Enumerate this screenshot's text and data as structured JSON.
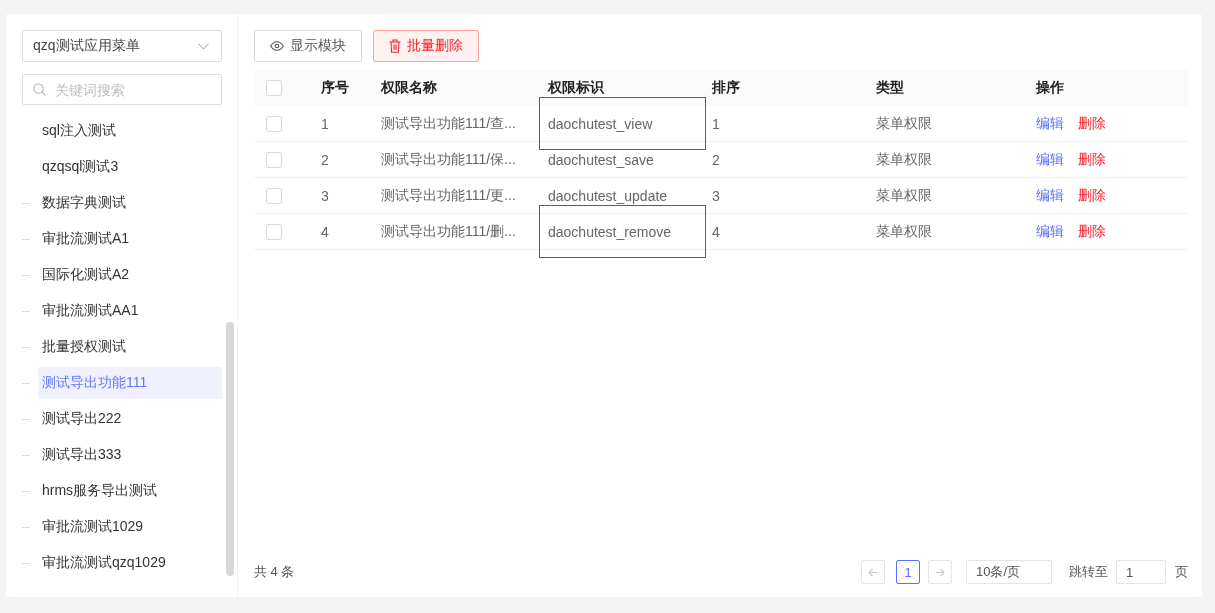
{
  "sidebar": {
    "menu_select": {
      "value": "qzq测试应用菜单"
    },
    "search": {
      "placeholder": "关键词搜索"
    },
    "tree": [
      {
        "label": "sql注入测试",
        "kind": "nested",
        "selected": false
      },
      {
        "label": "qzqsql测试3",
        "kind": "nested",
        "selected": false
      },
      {
        "label": "数据字典测试",
        "kind": "top",
        "selected": false
      },
      {
        "label": "审批流测试A1",
        "kind": "top",
        "selected": false
      },
      {
        "label": "国际化测试A2",
        "kind": "top",
        "selected": false
      },
      {
        "label": "审批流测试AA1",
        "kind": "top",
        "selected": false
      },
      {
        "label": "批量授权测试",
        "kind": "top",
        "selected": false
      },
      {
        "label": "测试导出功能111",
        "kind": "top",
        "selected": true
      },
      {
        "label": "测试导出222",
        "kind": "top",
        "selected": false
      },
      {
        "label": "测试导出333",
        "kind": "top",
        "selected": false
      },
      {
        "label": "hrms服务导出测试",
        "kind": "top",
        "selected": false
      },
      {
        "label": "审批流测试1029",
        "kind": "top",
        "selected": false
      },
      {
        "label": "审批流测试qzq1029",
        "kind": "top",
        "selected": false
      }
    ]
  },
  "toolbar": {
    "buttons": [
      {
        "label": "显示模块",
        "kind": "plain"
      },
      {
        "label": "批量删除",
        "kind": "danger"
      }
    ]
  },
  "table": {
    "select_all": {
      "checked": false
    },
    "columns": [
      "序号",
      "权限名称",
      "权限标识",
      "排序",
      "类型",
      "操作"
    ],
    "rows": [
      {
        "checked": false,
        "index": "1",
        "name": "测试导出功能111/查...",
        "identifier": "daochutest_view",
        "sort": "1",
        "type": "菜单权限",
        "marked": true,
        "actions": [
          {
            "label": "编辑",
            "kind": "edit"
          },
          {
            "label": "删除",
            "kind": "delete"
          }
        ]
      },
      {
        "checked": false,
        "index": "2",
        "name": "测试导出功能111/保...",
        "identifier": "daochutest_save",
        "sort": "2",
        "type": "菜单权限",
        "marked": false,
        "actions": [
          {
            "label": "编辑",
            "kind": "edit"
          },
          {
            "label": "删除",
            "kind": "delete"
          }
        ]
      },
      {
        "checked": false,
        "index": "3",
        "name": "测试导出功能111/更...",
        "identifier": "daochutest_update",
        "sort": "3",
        "type": "菜单权限",
        "marked": false,
        "actions": [
          {
            "label": "编辑",
            "kind": "edit"
          },
          {
            "label": "删除",
            "kind": "delete"
          }
        ]
      },
      {
        "checked": false,
        "index": "4",
        "name": "测试导出功能111/删...",
        "identifier": "daochutest_remove",
        "sort": "4",
        "type": "菜单权限",
        "marked": true,
        "actions": [
          {
            "label": "编辑",
            "kind": "edit"
          },
          {
            "label": "删除",
            "kind": "delete"
          }
        ]
      }
    ]
  },
  "pagination": {
    "total": "共 4 条",
    "prev": {
      "disabled": true
    },
    "pages": [
      {
        "label": "1",
        "selected": true
      }
    ],
    "next": {
      "disabled": true
    },
    "page_size": "10条/页",
    "jump_label": "跳转至",
    "jump_value": "1",
    "jump_suffix": "页"
  }
}
